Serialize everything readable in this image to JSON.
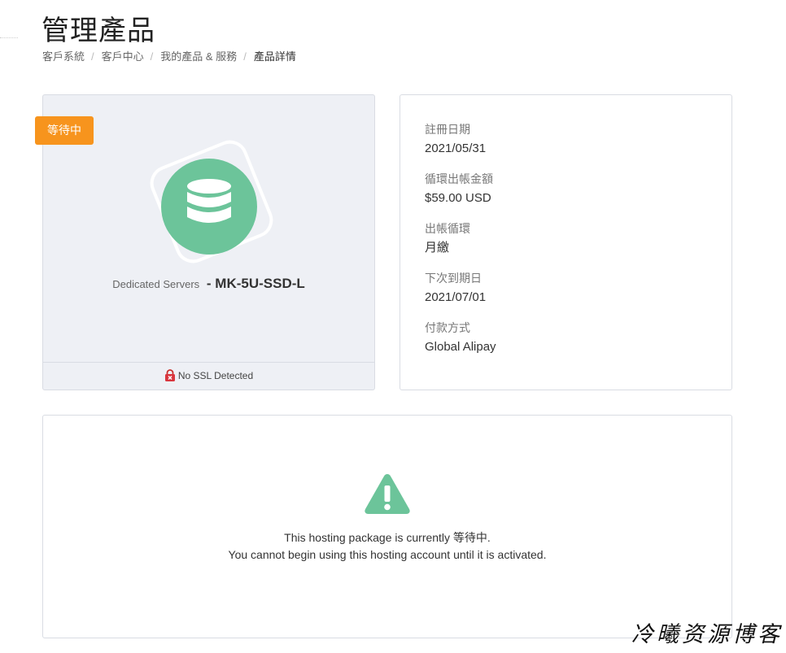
{
  "header": {
    "title": "管理產品",
    "breadcrumb": [
      {
        "label": "客戶系統"
      },
      {
        "label": "客戶中心"
      },
      {
        "label": "我的產品 & 服務"
      },
      {
        "label": "產品詳情"
      }
    ]
  },
  "product": {
    "status": "等待中",
    "status_color": "#f7941d",
    "icon": "database-icon",
    "icon_color": "#6cc49a",
    "group": "Dedicated Servers",
    "separator": " - ",
    "name": "MK-5U-SSD-L",
    "ssl_icon": "padlock-error-icon",
    "ssl_text": "No SSL Detected"
  },
  "details": {
    "reg_date_label": "註冊日期",
    "reg_date_value": "2021/05/31",
    "recurring_label": "循環出帳金額",
    "recurring_value": "$59.00 USD",
    "cycle_label": "出帳循環",
    "cycle_value": "月繳",
    "next_due_label": "下次到期日",
    "next_due_value": "2021/07/01",
    "payment_label": "付款方式",
    "payment_value": "Global Alipay"
  },
  "notice": {
    "icon": "warning-icon",
    "line1": "This hosting package is currently 等待中.",
    "line2": "You cannot begin using this hosting account until it is activated."
  },
  "watermark": "冷曦资源博客"
}
